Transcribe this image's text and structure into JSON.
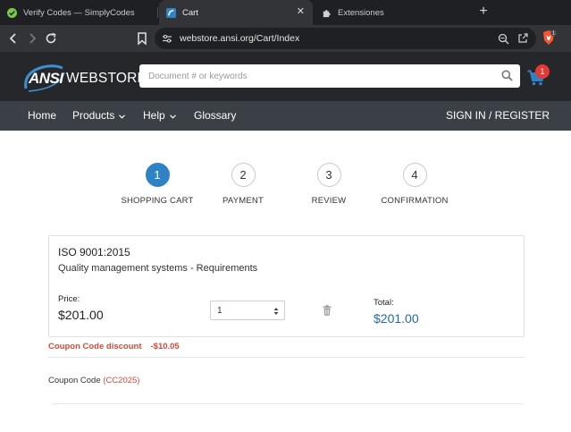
{
  "browser": {
    "tabs": [
      {
        "title": "Verify Codes — SimplyCodes",
        "active": false
      },
      {
        "title": "Cart",
        "active": true
      },
      {
        "title": "Extensiones",
        "active": false
      }
    ],
    "new_tab_label": "+",
    "close_label": "✕",
    "url": "webstore.ansi.org/Cart/Index",
    "brave_badge": "1"
  },
  "header": {
    "logo_ansi": "ANSI",
    "logo_webstore": "WEBSTORE",
    "search_placeholder": "Document # or keywords",
    "cart_count": "1"
  },
  "nav": {
    "items": [
      {
        "label": "Home",
        "has_dropdown": false
      },
      {
        "label": "Products",
        "has_dropdown": true
      },
      {
        "label": "Help",
        "has_dropdown": true
      },
      {
        "label": "Glossary",
        "has_dropdown": false
      }
    ],
    "sign_in": "SIGN IN / REGISTER"
  },
  "steps": [
    {
      "number": "1",
      "label": "SHOPPING CART",
      "active": true
    },
    {
      "number": "2",
      "label": "PAYMENT",
      "active": false
    },
    {
      "number": "3",
      "label": "REVIEW",
      "active": false
    },
    {
      "number": "4",
      "label": "CONFIRMATION",
      "active": false
    }
  ],
  "cart_item": {
    "code": "ISO 9001:2015",
    "title": "Quality management systems - Requirements",
    "price_label": "Price:",
    "price": "$201.00",
    "quantity": "1",
    "total_label": "Total:",
    "total": "$201.00"
  },
  "coupon": {
    "discount_label": "Coupon Code discount",
    "discount_amount": "-$10.05",
    "code_label": "Coupon Code",
    "code": "(CC2025)"
  },
  "colors": {
    "accent_blue": "#2f82c4",
    "total_blue": "#1f6aa5",
    "coupon_red": "#d9493a",
    "badge_red": "#e53935",
    "header_dark": "#25272b",
    "nav_gray": "#3b4046"
  }
}
